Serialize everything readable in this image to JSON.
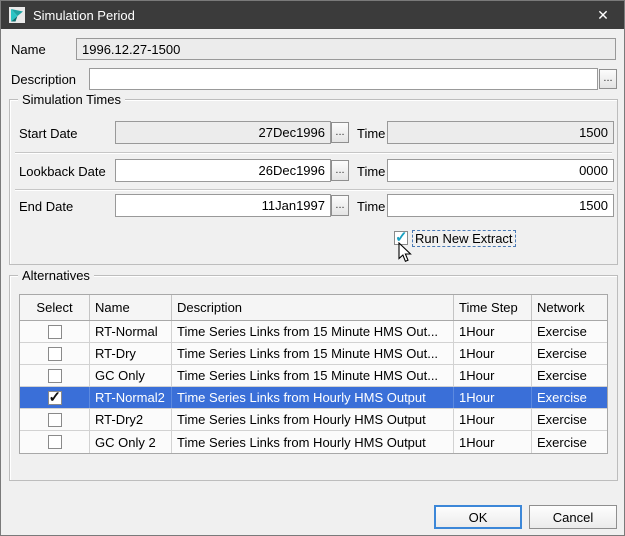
{
  "window": {
    "title": "Simulation Period",
    "close_icon": "✕",
    "app_icon": "ressim-logo-icon"
  },
  "fields": {
    "name_label": "Name",
    "name_value": "1996.12.27-1500",
    "description_label": "Description",
    "description_value": "",
    "ellipsis": "..."
  },
  "simulation_times": {
    "legend": "Simulation Times",
    "rows": [
      {
        "label": "Start Date",
        "date": "27Dec1996",
        "time_label": "Time",
        "time": "1500"
      },
      {
        "label": "Lookback Date",
        "date": "26Dec1996",
        "time_label": "Time",
        "time": "0000"
      },
      {
        "label": "End Date",
        "date": "11Jan1997",
        "time_label": "Time",
        "time": "1500"
      }
    ],
    "run_new_extract": {
      "label": "Run New Extract",
      "checked": true
    }
  },
  "alternatives": {
    "legend": "Alternatives",
    "columns": [
      "Select",
      "Name",
      "Description",
      "Time Step",
      "Network"
    ],
    "rows": [
      {
        "selected": false,
        "name": "RT-Normal",
        "description": "Time Series Links from 15 Minute HMS Out...",
        "time_step": "1Hour",
        "network": "Exercise"
      },
      {
        "selected": false,
        "name": "RT-Dry",
        "description": "Time Series Links from 15 Minute HMS Out...",
        "time_step": "1Hour",
        "network": "Exercise"
      },
      {
        "selected": false,
        "name": "GC Only",
        "description": "Time Series Links from 15 Minute HMS Out...",
        "time_step": "1Hour",
        "network": "Exercise"
      },
      {
        "selected": true,
        "name": "RT-Normal2",
        "description": "Time Series Links from Hourly HMS Output",
        "time_step": "1Hour",
        "network": "Exercise"
      },
      {
        "selected": false,
        "name": "RT-Dry2",
        "description": "Time Series Links from Hourly HMS Output",
        "time_step": "1Hour",
        "network": "Exercise"
      },
      {
        "selected": false,
        "name": "GC Only 2",
        "description": "Time Series Links from Hourly HMS Output",
        "time_step": "1Hour",
        "network": "Exercise"
      }
    ],
    "highlighted_row_index": 3
  },
  "buttons": {
    "ok": "OK",
    "cancel": "Cancel"
  }
}
